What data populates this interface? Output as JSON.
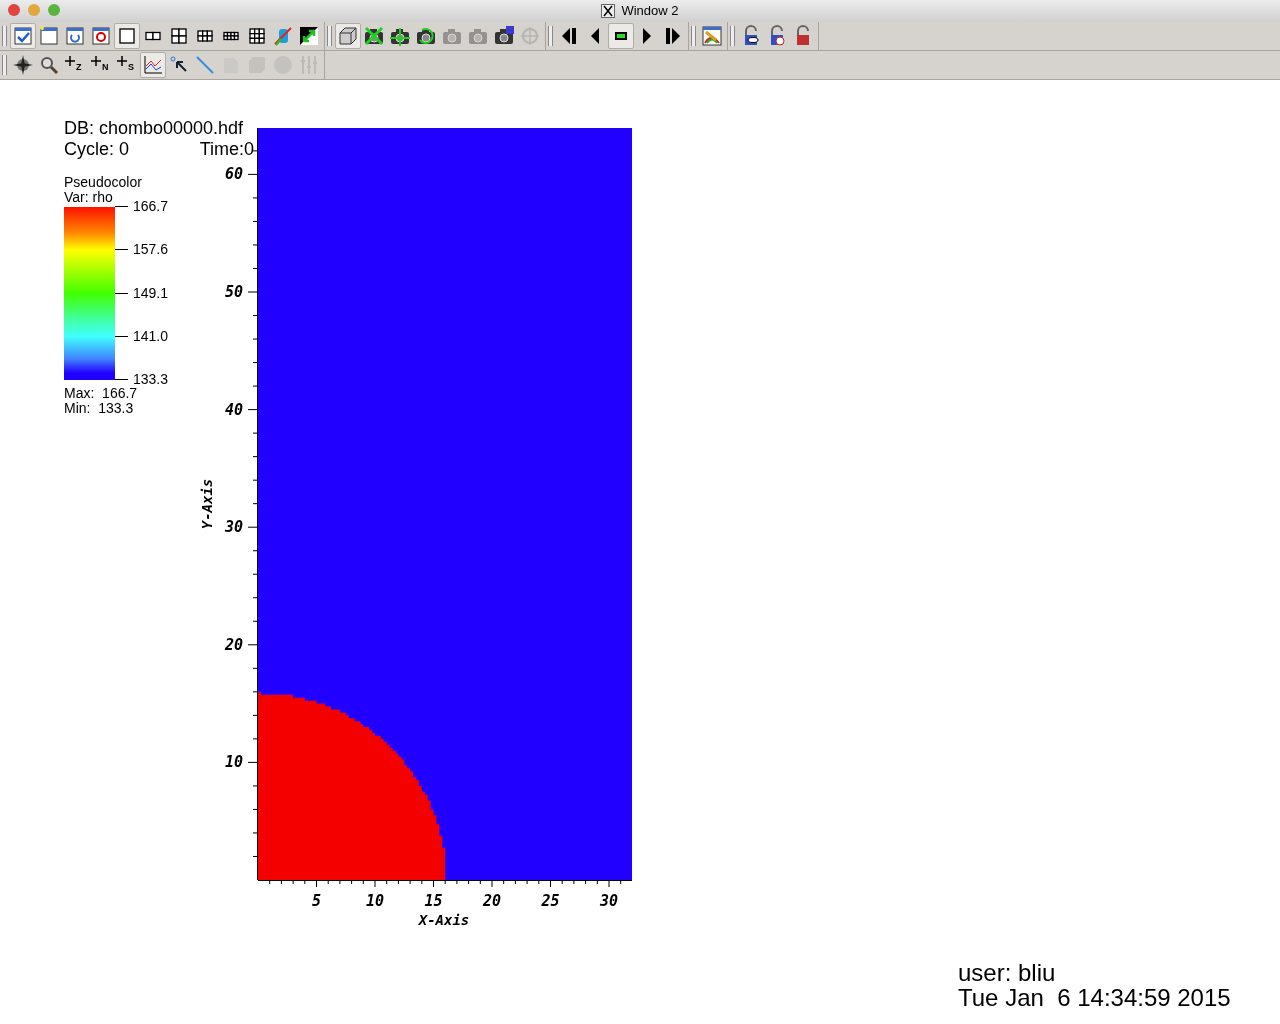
{
  "window": {
    "title": "Window 2"
  },
  "toolbar_rows": [
    [
      [
        {
          "kind": "window-check",
          "pressed": true,
          "disabled": false
        },
        {
          "kind": "window-new",
          "pressed": false,
          "disabled": false
        },
        {
          "kind": "window-clone",
          "pressed": false,
          "disabled": false
        },
        {
          "kind": "window-delete",
          "pressed": false,
          "disabled": false
        },
        {
          "kind": "layout-1",
          "pressed": true,
          "disabled": false
        },
        {
          "kind": "layout-2",
          "pressed": false,
          "disabled": false
        },
        {
          "kind": "layout-4",
          "pressed": false,
          "disabled": false
        },
        {
          "kind": "layout-6",
          "pressed": false,
          "disabled": false
        },
        {
          "kind": "layout-8",
          "pressed": false,
          "disabled": false
        },
        {
          "kind": "layout-9",
          "pressed": false,
          "disabled": false
        },
        {
          "kind": "cylinder-slash",
          "pressed": false,
          "disabled": false
        },
        {
          "kind": "invert",
          "pressed": false,
          "disabled": false
        }
      ],
      [
        {
          "kind": "box",
          "pressed": true,
          "disabled": false
        },
        {
          "kind": "camera-cross",
          "pressed": false,
          "disabled": false
        },
        {
          "kind": "camera-arrows",
          "pressed": false,
          "disabled": false
        },
        {
          "kind": "camera-undo",
          "pressed": false,
          "disabled": false
        },
        {
          "kind": "camera",
          "pressed": false,
          "disabled": true
        },
        {
          "kind": "camera",
          "pressed": false,
          "disabled": true
        },
        {
          "kind": "camera-save",
          "pressed": false,
          "disabled": false
        },
        {
          "kind": "crosshair",
          "pressed": false,
          "disabled": true
        }
      ],
      [
        {
          "kind": "first",
          "pressed": false,
          "disabled": false
        },
        {
          "kind": "prev",
          "pressed": false,
          "disabled": false
        },
        {
          "kind": "stop",
          "pressed": true,
          "disabled": false
        },
        {
          "kind": "play",
          "pressed": false,
          "disabled": false
        },
        {
          "kind": "last",
          "pressed": false,
          "disabled": false
        }
      ],
      [
        {
          "kind": "palette",
          "pressed": false,
          "disabled": false
        }
      ],
      [
        {
          "kind": "lock-eye",
          "pressed": false,
          "disabled": false
        },
        {
          "kind": "lock-clock",
          "pressed": false,
          "disabled": false
        },
        {
          "kind": "lock-red",
          "pressed": false,
          "disabled": false
        }
      ]
    ],
    [
      [
        {
          "kind": "compass",
          "pressed": false,
          "disabled": false
        },
        {
          "kind": "magnifier",
          "pressed": false,
          "disabled": false
        },
        {
          "kind": "pick",
          "label": "Z",
          "pressed": false,
          "disabled": false
        },
        {
          "kind": "pick",
          "label": "N",
          "pressed": false,
          "disabled": false
        },
        {
          "kind": "pick",
          "label": "S",
          "pressed": false,
          "disabled": false
        },
        {
          "kind": "curve",
          "pressed": true,
          "disabled": false
        },
        {
          "kind": "pointer",
          "pressed": false,
          "disabled": false
        },
        {
          "kind": "line",
          "pressed": false,
          "disabled": false
        },
        {
          "kind": "plane",
          "pressed": false,
          "disabled": true
        },
        {
          "kind": "cube",
          "pressed": false,
          "disabled": true
        },
        {
          "kind": "sphere",
          "pressed": false,
          "disabled": true
        },
        {
          "kind": "sliders",
          "pressed": false,
          "disabled": true
        }
      ]
    ]
  ],
  "annotations": {
    "database": "DB: chombo00000.hdf",
    "cycle": "Cycle: 0",
    "time": "Time:0"
  },
  "legend": {
    "plot_type": "Pseudocolor",
    "variable": "Var: rho",
    "ticks": [
      "166.7",
      "157.6",
      "149.1",
      "141.0",
      "133.3"
    ],
    "max": "Max:  166.7",
    "min": "Min:  133.3"
  },
  "plot": {
    "x_axis": {
      "title": "X-Axis",
      "ticks": [
        "5",
        "10",
        "15",
        "20",
        "25",
        "30"
      ]
    },
    "y_axis": {
      "title": "Y-Axis",
      "ticks": [
        "60",
        "50",
        "40",
        "30",
        "20",
        "10"
      ]
    }
  },
  "user_info": {
    "user": "user: bliu",
    "date": "Tue Jan  6 14:34:59 2015"
  }
}
